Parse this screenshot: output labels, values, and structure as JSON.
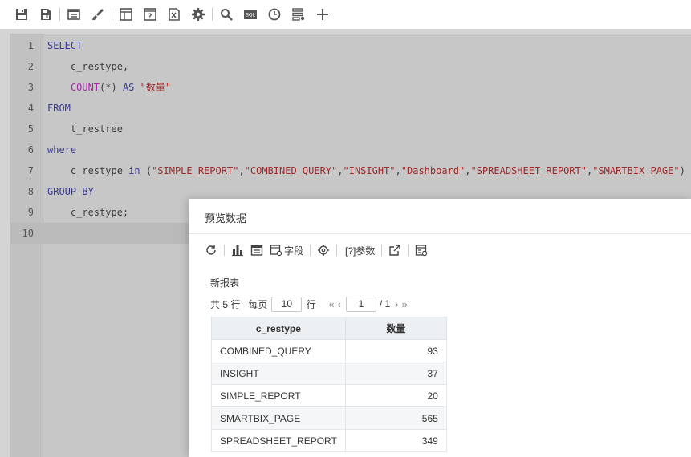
{
  "toolbar": {
    "buttons": [
      {
        "icon": "save-icon"
      },
      {
        "icon": "save-as-icon"
      },
      {
        "icon": "layout-icon"
      },
      {
        "icon": "brush-icon"
      },
      {
        "icon": "table-view-icon"
      },
      {
        "icon": "help-table-icon"
      },
      {
        "icon": "export-excel-icon"
      },
      {
        "icon": "gear-icon"
      },
      {
        "icon": "search-icon"
      },
      {
        "icon": "sql-icon",
        "text": "SQL"
      },
      {
        "icon": "clock-icon"
      },
      {
        "icon": "settings-list-icon"
      },
      {
        "icon": "plus-icon"
      }
    ]
  },
  "editor": {
    "lines": [
      {
        "num": "1",
        "tokens": [
          {
            "t": "SELECT",
            "c": "kw"
          }
        ]
      },
      {
        "num": "2",
        "tokens": [
          {
            "t": "    c_restype,",
            "c": "plain"
          }
        ]
      },
      {
        "num": "3",
        "tokens": [
          {
            "t": "    ",
            "c": "plain"
          },
          {
            "t": "COUNT",
            "c": "fn"
          },
          {
            "t": "(*) ",
            "c": "plain"
          },
          {
            "t": "AS",
            "c": "kw"
          },
          {
            "t": " ",
            "c": "plain"
          },
          {
            "t": "\"数量\"",
            "c": "str"
          }
        ]
      },
      {
        "num": "4",
        "tokens": [
          {
            "t": "FROM",
            "c": "kw"
          }
        ]
      },
      {
        "num": "5",
        "tokens": [
          {
            "t": "    t_restree",
            "c": "plain"
          }
        ]
      },
      {
        "num": "6",
        "tokens": [
          {
            "t": "where",
            "c": "kw"
          }
        ]
      },
      {
        "num": "7",
        "tokens": [
          {
            "t": "    c_restype ",
            "c": "plain"
          },
          {
            "t": "in",
            "c": "kw"
          },
          {
            "t": " (",
            "c": "plain"
          },
          {
            "t": "\"SIMPLE_REPORT\"",
            "c": "str"
          },
          {
            "t": ",",
            "c": "plain"
          },
          {
            "t": "\"COMBINED_QUERY\"",
            "c": "str"
          },
          {
            "t": ",",
            "c": "plain"
          },
          {
            "t": "\"INSIGHT\"",
            "c": "str"
          },
          {
            "t": ",",
            "c": "plain"
          },
          {
            "t": "\"Dashboard\"",
            "c": "str"
          },
          {
            "t": ",",
            "c": "plain"
          },
          {
            "t": "\"SPREADSHEET_REPORT\"",
            "c": "str"
          },
          {
            "t": ",",
            "c": "plain"
          },
          {
            "t": "\"SMARTBIX_PAGE\"",
            "c": "str"
          },
          {
            "t": ")",
            "c": "plain"
          }
        ]
      },
      {
        "num": "8",
        "tokens": [
          {
            "t": "GROUP BY",
            "c": "kw"
          }
        ]
      },
      {
        "num": "9",
        "tokens": [
          {
            "t": "    c_restype;",
            "c": "plain"
          }
        ]
      },
      {
        "num": "10",
        "tokens": []
      }
    ]
  },
  "dialog": {
    "title": "预览数据",
    "tools": [
      {
        "icon": "refresh-icon",
        "label": ""
      },
      {
        "icon": "bar-chart-icon",
        "label": ""
      },
      {
        "icon": "table-icon",
        "label": ""
      },
      {
        "icon": "field-settings-icon",
        "label": "字段"
      },
      {
        "icon": "gear-icon",
        "label": ""
      },
      {
        "icon": "params-icon",
        "label": "[?]参数"
      },
      {
        "icon": "open-external-icon",
        "label": ""
      },
      {
        "icon": "report-settings-icon",
        "label": ""
      }
    ],
    "report_name": "新报表",
    "pager": {
      "total_prefix": "共 5 行",
      "per_page_label": "每页",
      "per_page_value": "10",
      "rows_suffix": "行",
      "first": "«",
      "prev": "‹",
      "current_page": "1",
      "total_pages": "/ 1",
      "next": "›",
      "last": "»"
    },
    "table": {
      "headers": [
        "c_restype",
        "数量"
      ],
      "rows": [
        [
          "COMBINED_QUERY",
          "93"
        ],
        [
          "INSIGHT",
          "37"
        ],
        [
          "SIMPLE_REPORT",
          "20"
        ],
        [
          "SMARTBIX_PAGE",
          "565"
        ],
        [
          "SPREADSHEET_REPORT",
          "349"
        ]
      ]
    }
  }
}
